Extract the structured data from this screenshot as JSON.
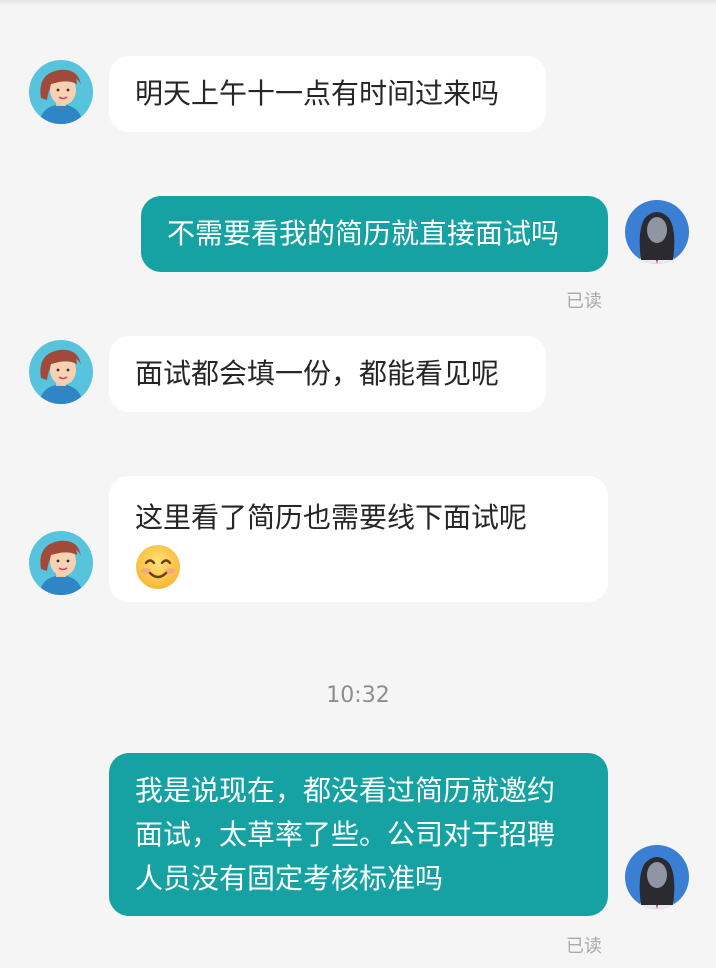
{
  "messages": [
    {
      "side": "in",
      "text": "明天上午十一点有时间过来吗"
    },
    {
      "side": "out",
      "text": "不需要看我的简历就直接面试吗",
      "status": "已读"
    },
    {
      "side": "in",
      "text": "面试都会填一份，都能看见呢"
    },
    {
      "side": "in",
      "text": "这里看了简历也需要线下面试呢",
      "emoji": "smiling-face-emoji"
    },
    {
      "side": "out",
      "text": "我是说现在，都没看过简历就邀约面试，太草率了些。公司对于招聘人员没有固定考核标准吗",
      "status": "已读"
    }
  ],
  "timestamp": "10:32",
  "colors": {
    "background": "#f5f5f5",
    "outgoing_bubble": "#16a2a2",
    "incoming_bubble": "#ffffff",
    "status": "#a9a9a9"
  },
  "icons": {
    "recruiter_avatar": "male-cartoon-avatar",
    "user_avatar": "female-avatar",
    "emoji": "smiling-face-emoji"
  }
}
